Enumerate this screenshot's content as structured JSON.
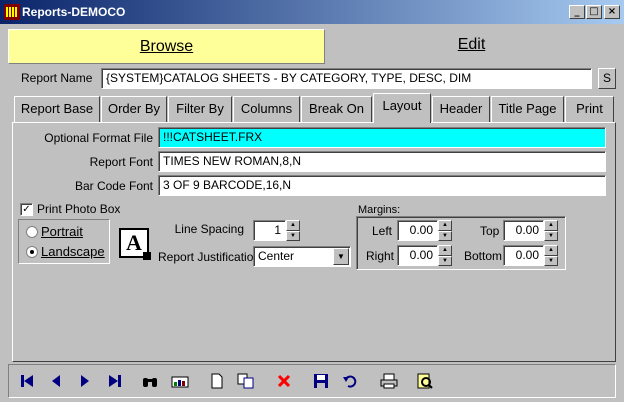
{
  "window": {
    "title": "Reports-DEMOCO"
  },
  "mode_tabs": {
    "browse": "Browse",
    "edit": "Edit"
  },
  "report_name": {
    "label": "Report Name",
    "value": "{SYSTEM}CATALOG SHEETS - BY CATEGORY, TYPE, DESC, DIM",
    "side_button": "S"
  },
  "tabs": [
    "Report Base",
    "Order By",
    "Filter By",
    "Columns",
    "Break On",
    "Layout",
    "Header",
    "Title Page",
    "Print"
  ],
  "active_tab": "Layout",
  "layout": {
    "optional_format_file": {
      "label": "Optional Format File",
      "value": "!!!CATSHEET.FRX"
    },
    "report_font": {
      "label": "Report Font",
      "value": "TIMES NEW ROMAN,8,N"
    },
    "bar_code_font": {
      "label": "Bar Code Font",
      "value": "3 OF 9 BARCODE,16,N"
    },
    "print_photo_box": {
      "label": "Print Photo Box",
      "checked": true
    },
    "orientation": {
      "portrait": "Portrait",
      "landscape": "Landscape",
      "selected": "Landscape"
    },
    "font_icon_glyph": "A",
    "line_spacing": {
      "label": "Line Spacing",
      "value": "1"
    },
    "report_justification": {
      "label": "Report Justification",
      "value": "Center"
    },
    "margins": {
      "title": "Margins:",
      "left": {
        "label": "Left",
        "value": "0.00"
      },
      "right": {
        "label": "Right",
        "value": "0.00"
      },
      "top": {
        "label": "Top",
        "value": "0.00"
      },
      "bottom": {
        "label": "Bottom",
        "value": "0.00"
      }
    }
  },
  "colors": {
    "browse_tab": "#ffff99",
    "format_file_field": "#00ffff",
    "title_bar": "#0a246a"
  }
}
